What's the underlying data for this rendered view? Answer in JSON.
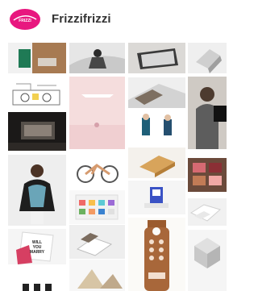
{
  "profile": {
    "name": "Frizzifrizzi",
    "logo_text": "FRIZZIFRIZZI",
    "logo_color": "#e8177f"
  },
  "gallery": {
    "columns": 4,
    "images": [
      "desk-with-green-object",
      "seated-figure-sculpture",
      "graphic-card-on-dark",
      "folded-paper-object",
      "line-drawing-illustration",
      "pink-minimal-scene",
      "architectural-model",
      "person-in-grey-wall",
      "dark-interior-room",
      "two-figurines",
      "woman-in-black-top",
      "bicycle-on-white",
      "wooden-stand",
      "blue-ornament",
      "book-in-pink",
      "color-swatches-shelf",
      "paper-card-sculpture",
      "tiled-pattern",
      "will-you-marry-me-book",
      "cabinet-drawers",
      "wooden-door-hanger",
      "white-bowl",
      "pink-box",
      "abstract-tiles"
    ],
    "book_text": "WILL YOU MARRY ME?"
  }
}
